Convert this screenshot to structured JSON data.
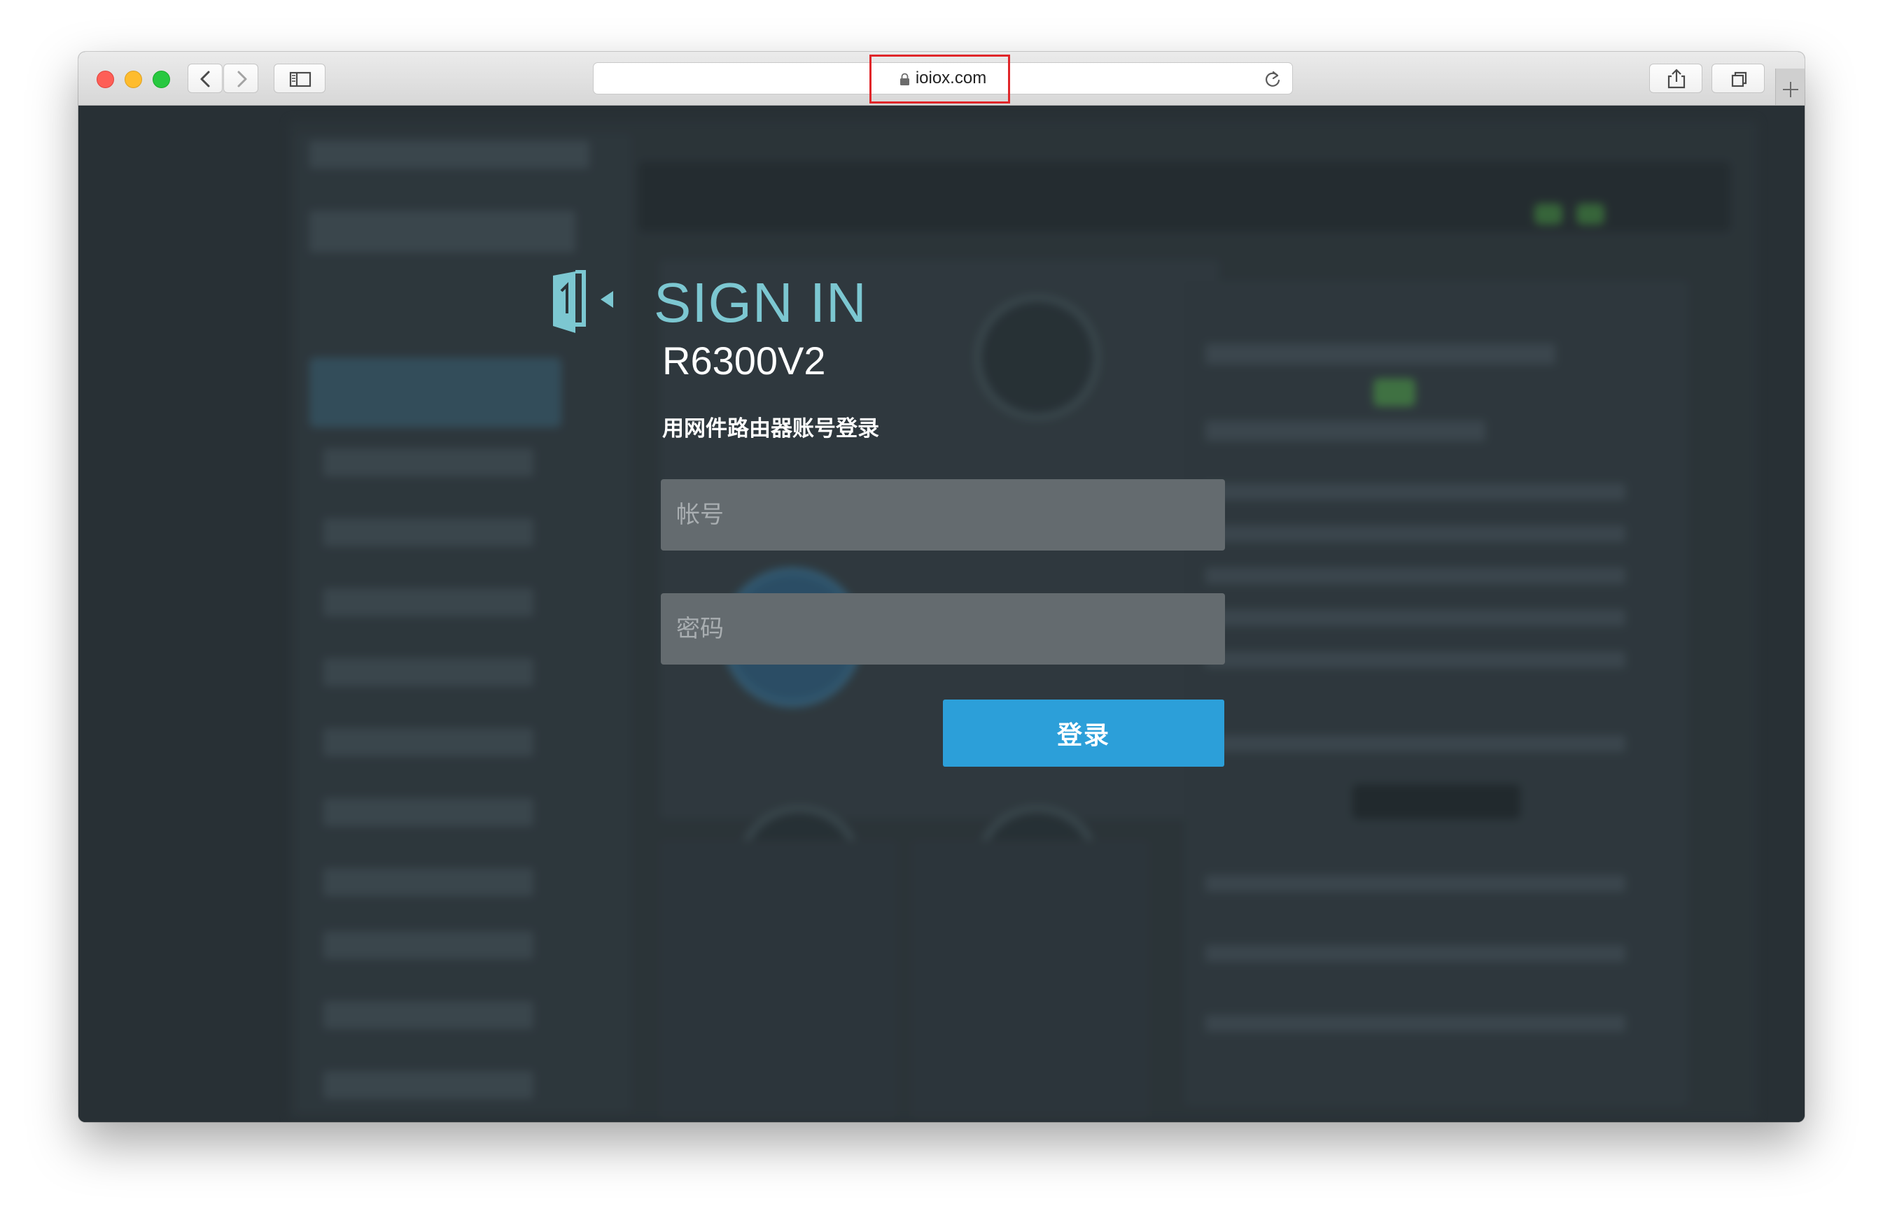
{
  "browser": {
    "url": "ioiox.com",
    "highlight_color": "#e0262a",
    "icons": {
      "back": "chevron-left-icon",
      "forward": "chevron-right-icon",
      "sidebar": "sidebar-icon",
      "lock": "lock-icon",
      "reload": "reload-icon",
      "share": "share-icon",
      "tabs": "tabs-overview-icon",
      "new_tab": "plus-icon"
    }
  },
  "login": {
    "title": "SIGN IN",
    "title_color": "#7cc7d1",
    "model": "R6300V2",
    "subtitle": "用网件路由器账号登录",
    "username_placeholder": "帐号",
    "password_placeholder": "密码",
    "submit_label": "登录",
    "submit_color": "#2c9fd9",
    "icon": "sign-in-door-icon"
  }
}
